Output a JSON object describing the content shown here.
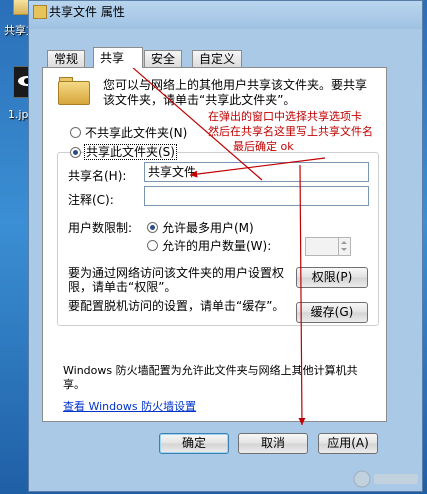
{
  "desktop": {
    "icon1_label": "共享文",
    "icon2_label": "1.jp"
  },
  "window": {
    "title": "共享文件 属性"
  },
  "tabs": [
    {
      "label": "常规"
    },
    {
      "label": "共享"
    },
    {
      "label": "安全"
    },
    {
      "label": "自定义"
    }
  ],
  "share_tab": {
    "description": "您可以与网络上的其他用户共享该文件夹。要共享该文件夹，请单击“共享此文件夹”。",
    "radio_no_share": "不共享此文件夹(N)",
    "radio_share": "共享此文件夹(S)",
    "share_name_label": "共享名(H):",
    "share_name_value": "共享文件",
    "comment_label": "注释(C):",
    "comment_value": "",
    "user_limit_label": "用户数限制:",
    "radio_max_users": "允许最多用户(M)",
    "radio_allowed_users": "允许的用户数量(W):",
    "permissions_text": "要为通过网络访问该文件夹的用户设置权限，请单击“权限”。",
    "permissions_button": "权限(P)",
    "caching_text": "要配置脱机访问的设置，请单击“缓存”。",
    "caching_button": "缓存(G)",
    "firewall_text": "Windows 防火墙配置为允许此文件夹与网络上其他计算机共享。",
    "firewall_link": "查看 Windows 防火墙设置"
  },
  "annotation": {
    "line1": "在弹出的窗口中选择共享选项卡",
    "line2": "然后在共享名这里写上共享文件名",
    "line3": "最后确定 ok",
    "color": "#c00000"
  },
  "footer": {
    "ok": "确定",
    "cancel": "取消",
    "apply": "应用(A)"
  }
}
